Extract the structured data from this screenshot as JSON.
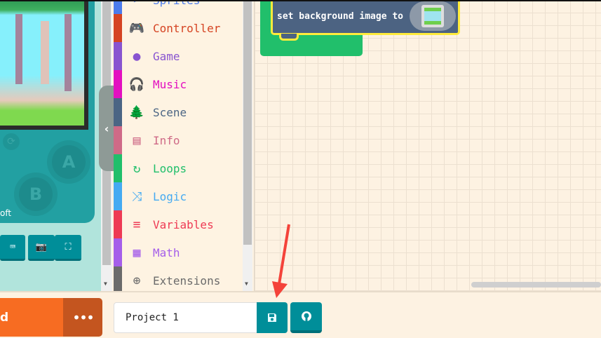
{
  "simulator": {
    "brand_fragment": "oft",
    "button_a": "A",
    "button_b": "B"
  },
  "toolbox": {
    "categories": [
      {
        "label": "Sprites",
        "color": "#4b7bec",
        "icon": "sprite-icon",
        "glyph": "➤"
      },
      {
        "label": "Controller",
        "color": "#d54322",
        "icon": "gamepad-icon",
        "glyph": "🎮"
      },
      {
        "label": "Game",
        "color": "#8854d0",
        "icon": "circle-icon",
        "glyph": "●"
      },
      {
        "label": "Music",
        "color": "#e30fc0",
        "icon": "headphones-icon",
        "glyph": "🎧"
      },
      {
        "label": "Scene",
        "color": "#4b6584",
        "icon": "tree-icon",
        "glyph": "🌲"
      },
      {
        "label": "Info",
        "color": "#cf6a87",
        "icon": "id-card-icon",
        "glyph": "▤"
      },
      {
        "label": "Loops",
        "color": "#20bf6b",
        "icon": "loop-icon",
        "glyph": "↻"
      },
      {
        "label": "Logic",
        "color": "#45aaf2",
        "icon": "shuffle-icon",
        "glyph": "⤨"
      },
      {
        "label": "Variables",
        "color": "#ee3a54",
        "icon": "list-icon",
        "glyph": "≡"
      },
      {
        "label": "Math",
        "color": "#a55eea",
        "icon": "calculator-icon",
        "glyph": "▦"
      },
      {
        "label": "Extensions",
        "color": "#6b6b6b",
        "icon": "plus-circle-icon",
        "glyph": "⊕"
      }
    ]
  },
  "workspace": {
    "block_text": "set background image to"
  },
  "bottom": {
    "download_fragment": "d",
    "more_label": "•••",
    "project_name": "Project 1",
    "save_glyph": "💾",
    "github_glyph": "⌥"
  }
}
